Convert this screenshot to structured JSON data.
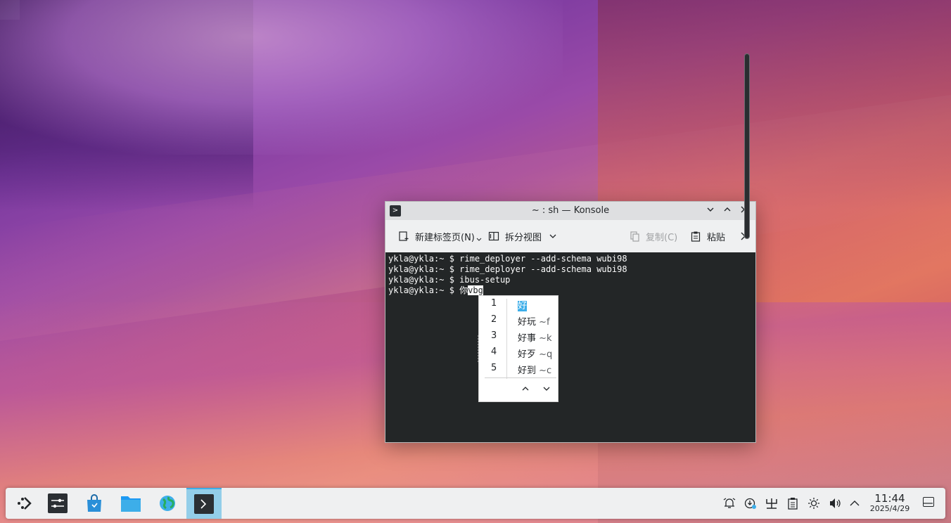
{
  "window": {
    "title": "~ : sh — Konsole",
    "app_icon": "terminal-icon"
  },
  "toolbar": {
    "new_tab": "新建标签页(N)",
    "split_view": "拆分视图",
    "copy": "复制(C)",
    "paste": "粘贴"
  },
  "terminal": {
    "lines": [
      "ykla@ykla:~ $ rime_deployer --add-schema wubi98",
      "ykla@ykla:~ $ rime_deployer --add-schema wubi98",
      "ykla@ykla:~ $ ibus-setup"
    ],
    "prompt": "ykla@ykla:~ $ ",
    "committed": "你",
    "preedit": "vbg"
  },
  "ime": {
    "candidates": [
      {
        "num": "1",
        "text": "好",
        "hint": ""
      },
      {
        "num": "2",
        "text": "好玩",
        "hint": " ~f"
      },
      {
        "num": "3",
        "text": "好事",
        "hint": " ~k"
      },
      {
        "num": "4",
        "text": "好歹",
        "hint": " ~q"
      },
      {
        "num": "5",
        "text": "好到",
        "hint": " ~c"
      }
    ],
    "prev": "^",
    "next": "v"
  },
  "panel": {
    "time": "11:44",
    "date": "2025/4/29",
    "accent": "#3daee9"
  }
}
